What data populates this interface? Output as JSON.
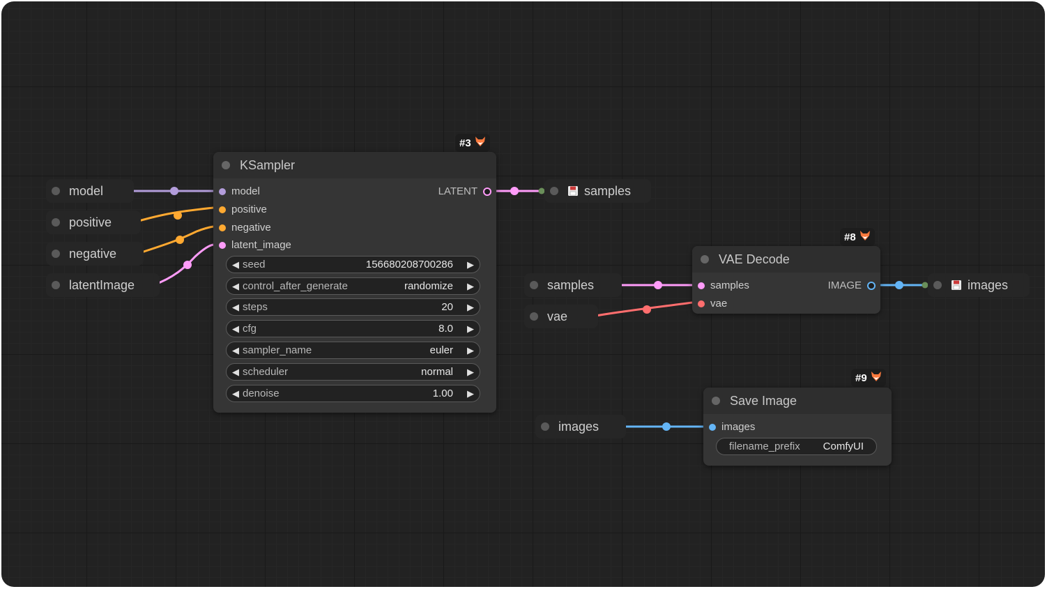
{
  "colors": {
    "model": "#b39ddb",
    "conditioning": "#ffa931",
    "latent": "#ff9cf9",
    "vae": "#ff6e6e",
    "image": "#64b5f6",
    "input_link": "#6a8f5a"
  },
  "inputs": [
    {
      "label": "model"
    },
    {
      "label": "positive"
    },
    {
      "label": "negative"
    },
    {
      "label": "latentImage"
    }
  ],
  "ksampler": {
    "badge": "#3",
    "badge_icon": "fox-icon",
    "title": "KSampler",
    "inputs": [
      "model",
      "positive",
      "negative",
      "latent_image"
    ],
    "output": "LATENT",
    "widgets": [
      {
        "name": "seed",
        "value": "156680208700286"
      },
      {
        "name": "control_after_generate",
        "value": "randomize"
      },
      {
        "name": "steps",
        "value": "20"
      },
      {
        "name": "cfg",
        "value": "8.0"
      },
      {
        "name": "sampler_name",
        "value": "euler"
      },
      {
        "name": "scheduler",
        "value": "normal"
      },
      {
        "name": "denoise",
        "value": "1.00"
      }
    ]
  },
  "samples_output": {
    "label": "samples",
    "icon": "save-icon"
  },
  "vae_decode": {
    "badge": "#8",
    "badge_icon": "fox-icon",
    "title": "VAE Decode",
    "inputs": [
      "samples",
      "vae"
    ],
    "output": "IMAGE",
    "external_inputs": [
      "samples",
      "vae"
    ]
  },
  "images_output": {
    "label": "images",
    "icon": "save-icon"
  },
  "save_image": {
    "badge": "#9",
    "badge_icon": "fox-icon",
    "title": "Save Image",
    "inputs": [
      "images"
    ],
    "external_input": "images",
    "widget": {
      "name": "filename_prefix",
      "value": "ComfyUI"
    }
  }
}
